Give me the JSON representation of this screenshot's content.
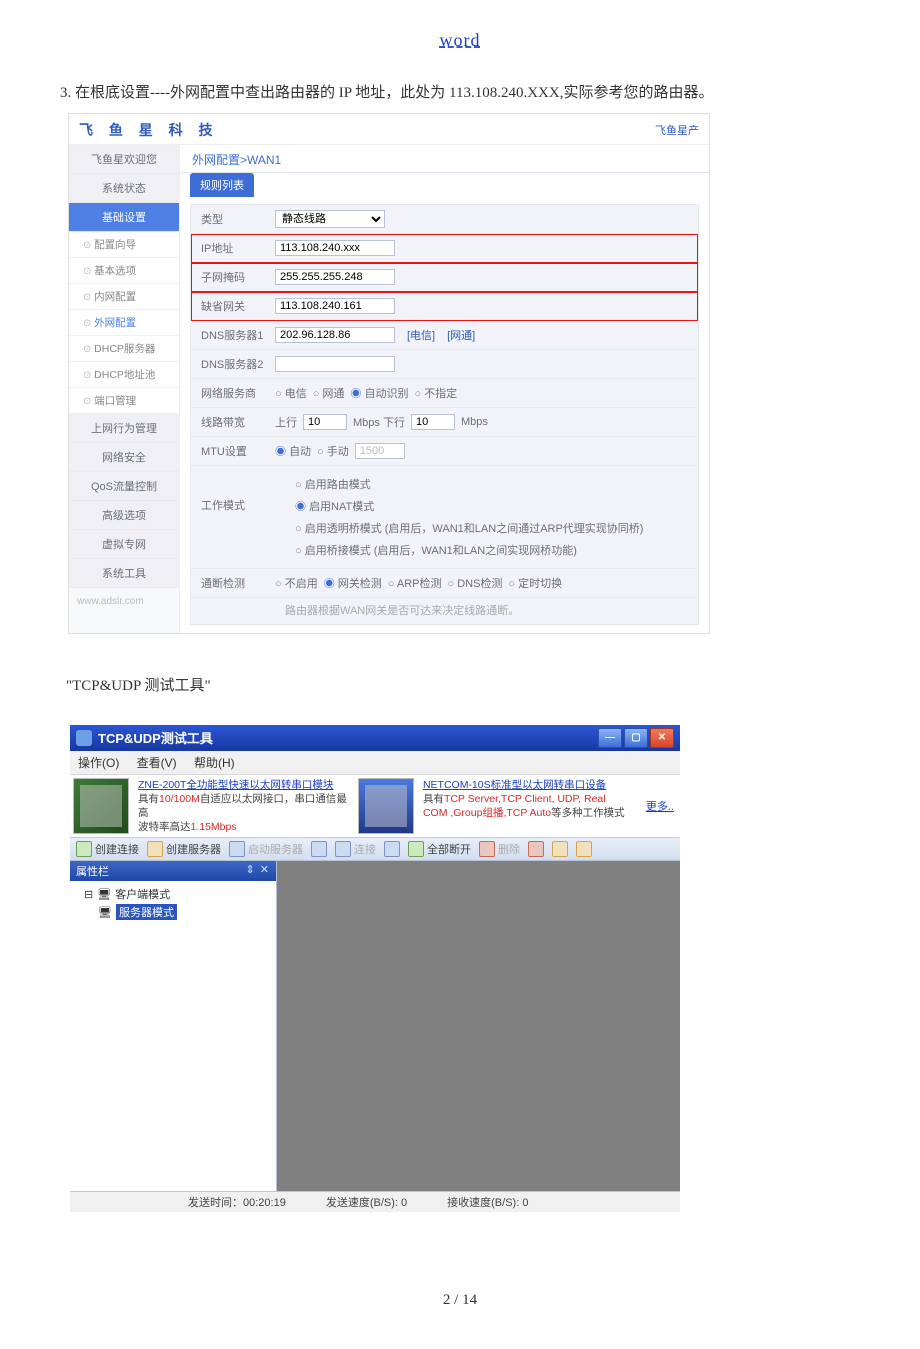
{
  "header_link": "word",
  "paragraph1": "3. 在根底设置----外网配置中查出路由器的 IP 地址，此处为 113.108.240.XXX,实际参考您的路由器。",
  "router": {
    "logo": "飞 鱼 星 科 技",
    "topright": "飞鱼星产",
    "sidebar_welcome": "飞鱼星欢迎您",
    "sidebar_sysstatus": "系统状态",
    "sidebar_basic": "基础设置",
    "sidebar_subs": [
      "配置向导",
      "基本选项",
      "内网配置",
      "外网配置",
      "DHCP服务器",
      "DHCP地址池",
      "端口管理"
    ],
    "sidebar_behavior": "上网行为管理",
    "sidebar_netsec": "网络安全",
    "sidebar_qos": "QoS流量控制",
    "sidebar_adv": "高级选项",
    "sidebar_vpn": "虚拟专网",
    "sidebar_tools": "系统工具",
    "sidebar_foot": "www.adslr.com",
    "breadcrumb": "外网配置>WAN1",
    "tab": "规则列表",
    "type_label": "类型",
    "type_value": "静态线路",
    "ip_label": "IP地址",
    "ip_value": "113.108.240.xxx",
    "mask_label": "子网掩码",
    "mask_value": "255.255.255.248",
    "gw_label": "缺省网关",
    "gw_value": "113.108.240.161",
    "dns1_label": "DNS服务器1",
    "dns1_value": "202.96.128.86",
    "dns1_l1": "[电信]",
    "dns1_l2": "[网通]",
    "dns2_label": "DNS服务器2",
    "isp_label": "网络服务商",
    "isp_opts": [
      "电信",
      "网通",
      "自动识别",
      "不指定"
    ],
    "bw_label": "线路带宽",
    "bw_up": "上行",
    "bw_down": "Mbps 下行",
    "bw_unit": "Mbps",
    "bw_up_val": "10",
    "bw_down_val": "10",
    "mtu_label": "MTU设置",
    "mtu_auto": "自动",
    "mtu_manual": "手动",
    "mtu_value": "1500",
    "mode_label": "工作模式",
    "mode_opts": [
      "启用路由模式",
      "启用NAT模式",
      "启用透明桥模式 (启用后，WAN1和LAN之间通过ARP代理实现协同桥)",
      "启用桥接模式 (启用后，WAN1和LAN之间实现网桥功能)"
    ],
    "chk_label": "通断检测",
    "chk_opts": [
      "不启用",
      "网关检测",
      "ARP检测",
      "DNS检测",
      "定时切换"
    ],
    "chk_note": "路由器根据WAN网关是否可达来决定线路通断。"
  },
  "tcpudp_section_label": "\"TCP&UDP 测试工具\"",
  "tool": {
    "title": "TCP&UDP测试工具",
    "menu": [
      "操作(O)",
      "查看(V)",
      "帮助(H)"
    ],
    "ad1_link": "ZNE-200T全功能型快速以太网转串口模块",
    "ad1_line2a": "具有",
    "ad1_line2b": "10/100M",
    "ad1_line2c": "自适应以太网接口，串口通信最高",
    "ad1_line3a": "波特率高达",
    "ad1_line3b": "1.15Mbps",
    "ad2_link": "NETCOM-10S标准型以太网转串口设备",
    "ad2_line2a": "具有",
    "ad2_line2b": "TCP Server,TCP Client, UDP, Real",
    "ad2_line3a": "COM ,Group组播,TCP Auto",
    "ad2_line3b": "等多种工作模式",
    "ad_more": "更多..",
    "tb_create_conn": "创建连接",
    "tb_create_srv": "创建服务器",
    "tb_start_srv": "启动服务器",
    "tb_connect": "连接",
    "tb_disconnect_all": "全部断开",
    "tb_delete": "删除",
    "prop_header": "属性栏",
    "prop_pins": "⇕ ✕",
    "tree_client": "客户端模式",
    "tree_server": "服务器模式",
    "status_time_lbl": "发送时间：",
    "status_time_val": "00:20:19",
    "status_send_lbl": "发送速度(B/S):",
    "status_send_val": "0",
    "status_recv_lbl": "接收速度(B/S):",
    "status_recv_val": "0"
  },
  "pagenum_a": "2",
  "pagenum_mid": " / ",
  "pagenum_b": "14"
}
